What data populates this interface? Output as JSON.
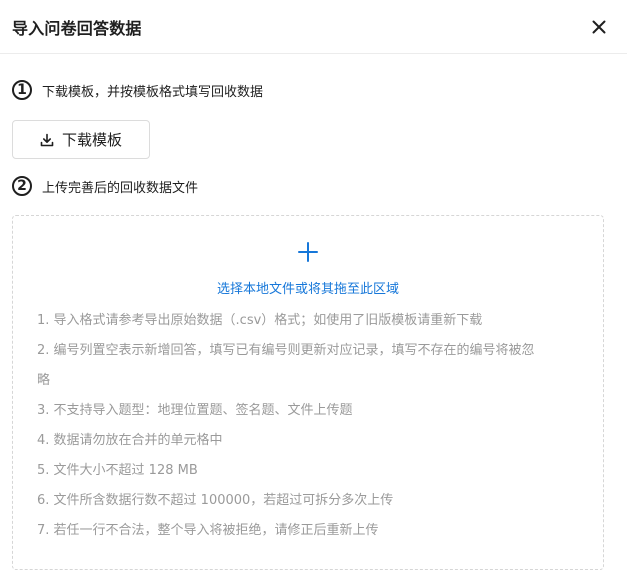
{
  "dialog": {
    "title": "导入问卷回答数据",
    "close_icon": "close-icon"
  },
  "steps": [
    {
      "number": "1",
      "text": "下载模板，并按模板格式填写回收数据"
    },
    {
      "number": "2",
      "text": "上传完善后的回收数据文件"
    }
  ],
  "download": {
    "label": "下载模板",
    "icon": "download-icon"
  },
  "upload": {
    "icon": "plus-icon",
    "prompt": "选择本地文件或将其拖至此区域",
    "prompt_color": "#1677d9"
  },
  "rules": [
    "1. 导入格式请参考导出原始数据（.csv）格式；如使用了旧版模板请重新下载",
    "2. 编号列置空表示新增回答，填写已有编号则更新对应记录，填写不存在的编号将被忽",
    "略",
    "3. 不支持导入题型：地理位置题、签名题、文件上传题",
    "4. 数据请勿放在合并的单元格中",
    "5. 文件大小不超过 128 MB",
    "6. 文件所含数据行数不超过 100000，若超过可拆分多次上传",
    "7. 若任一行不合法，整个导入将被拒绝，请修正后重新上传"
  ]
}
